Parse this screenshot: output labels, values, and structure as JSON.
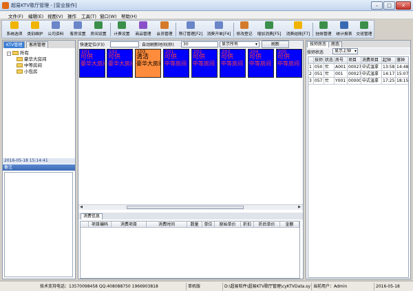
{
  "window": {
    "title": "超易KTV歌厅管理 - [营业操作]",
    "min": "–",
    "max": "□",
    "close": "×"
  },
  "menu": [
    "文件(F)",
    "编辑(E)",
    "视图(V)",
    "操作",
    "工具(T)",
    "窗口(W)",
    "帮助(H)"
  ],
  "toolbar": [
    {
      "label": "系统选项",
      "icon": "tools-icon",
      "color": "#f0b400"
    },
    {
      "label": "类别维护",
      "icon": "category-icon",
      "color": "#f0b400"
    },
    {
      "label": "公司资料",
      "icon": "company-icon",
      "color": "#6a85c8"
    },
    {
      "label": "客房设置",
      "icon": "room-settings-icon",
      "color": "#6a85c8"
    },
    {
      "label": "房间设置",
      "icon": "room-icon",
      "color": "#3c8f4a"
    },
    {
      "label": "计费设置",
      "icon": "billing-icon",
      "color": "#3c8f4a"
    },
    {
      "label": "商品管理",
      "icon": "goods-icon",
      "color": "#8a4fc8"
    },
    {
      "label": "会员管理",
      "icon": "member-icon",
      "color": "#d47a2a"
    },
    {
      "label": "预订管理[F2]",
      "icon": "booking-icon",
      "color": "#6a85c8"
    },
    {
      "label": "消费开单[F4]",
      "icon": "order-icon",
      "color": "#6a85c8"
    },
    {
      "label": "修改登记",
      "icon": "edit-icon",
      "color": "#d47a2a"
    },
    {
      "label": "增加消费[F5]",
      "icon": "add-consume-icon",
      "color": "#3c8f4a"
    },
    {
      "label": "消费结账[F7]",
      "icon": "checkout-icon",
      "color": "#f0b400"
    },
    {
      "label": "挂帐管理",
      "icon": "credit-icon",
      "color": "#3c8f4a"
    },
    {
      "label": "统计报表",
      "icon": "report-icon",
      "color": "#3a69b4"
    },
    {
      "label": "交班管理",
      "icon": "shift-icon",
      "color": "#3c8f4a"
    }
  ],
  "left": {
    "tabs": [
      "KTV管理",
      "客房管理"
    ],
    "tree": {
      "root": "所有",
      "children": [
        "豪华大房间",
        "中等房间",
        "小包房"
      ],
      "expander": "-"
    },
    "datetime": "2016-05-18 15:14:41",
    "remark_title": "备注"
  },
  "center": {
    "quick_locate_label": "快速定位(F3)",
    "quick_locate_value": "",
    "auto_refresh_label": "自动刷新时间(秒)",
    "auto_refresh_value": "30",
    "display_select": "显示所有",
    "refresh_button": "刷新",
    "rooms": [
      {
        "no": "101",
        "status": "可供",
        "type": "豪华大房间",
        "bg": "#0000ff",
        "fg": "#ff4040"
      },
      {
        "no": "102",
        "status": "可供",
        "type": "豪华大房间",
        "bg": "#0000ff",
        "fg": "#ff4040"
      },
      {
        "no": "103",
        "status": "清洁",
        "type": "豪华大房间",
        "bg": "#ff8c3c",
        "fg": "#000000"
      },
      {
        "no": "201",
        "status": "可供",
        "type": "中等房间",
        "bg": "#0000ff",
        "fg": "#ff4040"
      },
      {
        "no": "202",
        "status": "可供",
        "type": "中等房间",
        "bg": "#0000ff",
        "fg": "#ff4040"
      },
      {
        "no": "203",
        "status": "可供",
        "type": "中等房间",
        "bg": "#0000ff",
        "fg": "#ff4040"
      },
      {
        "no": "204",
        "status": "可供",
        "type": "中等房间",
        "bg": "#0000ff",
        "fg": "#ff4040"
      },
      {
        "no": "205",
        "status": "可供",
        "type": "中等房间",
        "bg": "#0000ff",
        "fg": "#ff4040"
      }
    ],
    "consume_tab": "消费信息",
    "consume_columns": [
      "项目编码",
      "消费项目",
      "消费时间",
      "数量",
      "单位",
      "原始单价",
      "折扣",
      "折后单价",
      "金额"
    ]
  },
  "right": {
    "tabs": [
      "技师房态",
      "房态"
    ],
    "filter_label": "技师状态",
    "filter_value": "显示上钟",
    "columns": [
      "",
      "技师",
      "状态",
      "房号",
      "项目",
      "消费项目",
      "起钟",
      "落钟"
    ],
    "rows": [
      [
        "1",
        "050",
        "忙",
        "A001",
        "00027",
        "中式温拿",
        "13:58",
        "14:48"
      ],
      [
        "2",
        "051",
        "忙",
        "001",
        "00027",
        "中式温拿",
        "14:17",
        "15:07"
      ],
      [
        "3",
        "057",
        "忙",
        "Y001",
        "00000",
        "中式温拿",
        "17:25",
        "18:15"
      ]
    ]
  },
  "status": {
    "support": "技术支持电话：13570098458 QQ:408088750 1966903818",
    "mode": "单机版",
    "path": "D:\\超易软件\\超易KTV歌厅管理\\cyKTVData.sys",
    "user": "当前用户：Admin",
    "date": "2016-05-18"
  }
}
